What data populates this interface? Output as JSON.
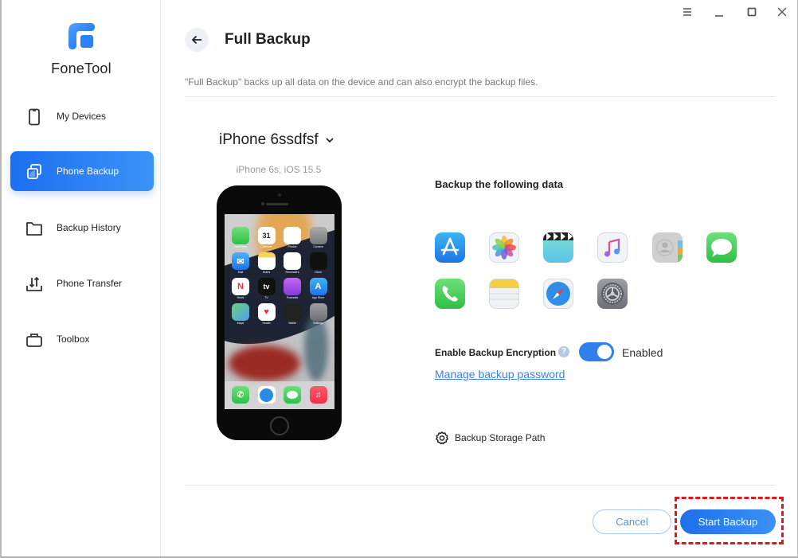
{
  "app": {
    "brand": "FoneTool",
    "accent_color": "#2f80ed",
    "highlight_color": "#e01818"
  },
  "window_controls": [
    {
      "name": "menu",
      "icon": "hamburger-icon"
    },
    {
      "name": "minimize",
      "icon": "minimize-icon"
    },
    {
      "name": "maximize",
      "icon": "maximize-icon"
    },
    {
      "name": "close",
      "icon": "close-icon"
    }
  ],
  "sidebar": {
    "items": [
      {
        "label": "My Devices",
        "icon": "phone-icon",
        "active": false
      },
      {
        "label": "Phone Backup",
        "icon": "backup-copy-icon",
        "active": true
      },
      {
        "label": "Backup History",
        "icon": "folder-icon",
        "active": false
      },
      {
        "label": "Phone Transfer",
        "icon": "transfer-icon",
        "active": false
      },
      {
        "label": "Toolbox",
        "icon": "toolbox-icon",
        "active": false
      }
    ]
  },
  "header": {
    "title": "Full Backup",
    "description": "\"Full Backup\" backs up all data on the device and can also encrypt the backup files."
  },
  "device": {
    "name": "iPhone 6ssdfsf",
    "model_info": "iPhone 6s, iOS 15.5",
    "home_screen_apps": [
      {
        "label": "FaceTime",
        "glyph": ""
      },
      {
        "label": "Calendar",
        "glyph": "31"
      },
      {
        "label": "Photos",
        "glyph": ""
      },
      {
        "label": "Camera",
        "glyph": ""
      },
      {
        "label": "Mail",
        "glyph": "✉"
      },
      {
        "label": "Notes",
        "glyph": ""
      },
      {
        "label": "Reminders",
        "glyph": ""
      },
      {
        "label": "Clock",
        "glyph": ""
      },
      {
        "label": "News",
        "glyph": "N"
      },
      {
        "label": "TV",
        "glyph": "tv"
      },
      {
        "label": "Podcasts",
        "glyph": ""
      },
      {
        "label": "App Store",
        "glyph": "A"
      },
      {
        "label": "Maps",
        "glyph": ""
      },
      {
        "label": "Health",
        "glyph": "♥"
      },
      {
        "label": "Wallet",
        "glyph": ""
      },
      {
        "label": "Settings",
        "glyph": ""
      }
    ],
    "dock_apps": [
      "Phone",
      "Safari",
      "Messages",
      "Music"
    ]
  },
  "backup": {
    "section_title": "Backup the following data",
    "data_types": [
      {
        "name": "apps",
        "icon": "app-store-icon"
      },
      {
        "name": "photos",
        "icon": "photos-icon"
      },
      {
        "name": "videos",
        "icon": "videos-icon"
      },
      {
        "name": "music",
        "icon": "music-icon"
      },
      {
        "name": "contacts",
        "icon": "contacts-icon"
      },
      {
        "name": "messages",
        "icon": "messages-icon"
      },
      {
        "name": "call-history",
        "icon": "phone-icon"
      },
      {
        "name": "notes",
        "icon": "notes-icon"
      },
      {
        "name": "safari",
        "icon": "safari-icon"
      },
      {
        "name": "settings",
        "icon": "settings-icon"
      }
    ],
    "encryption_label": "Enable Backup Encryption",
    "encryption_enabled": true,
    "encryption_state": "Enabled",
    "manage_password_link": "Manage backup password",
    "storage_path_label": "Backup Storage Path"
  },
  "footer": {
    "cancel_label": "Cancel",
    "start_label": "Start Backup"
  }
}
